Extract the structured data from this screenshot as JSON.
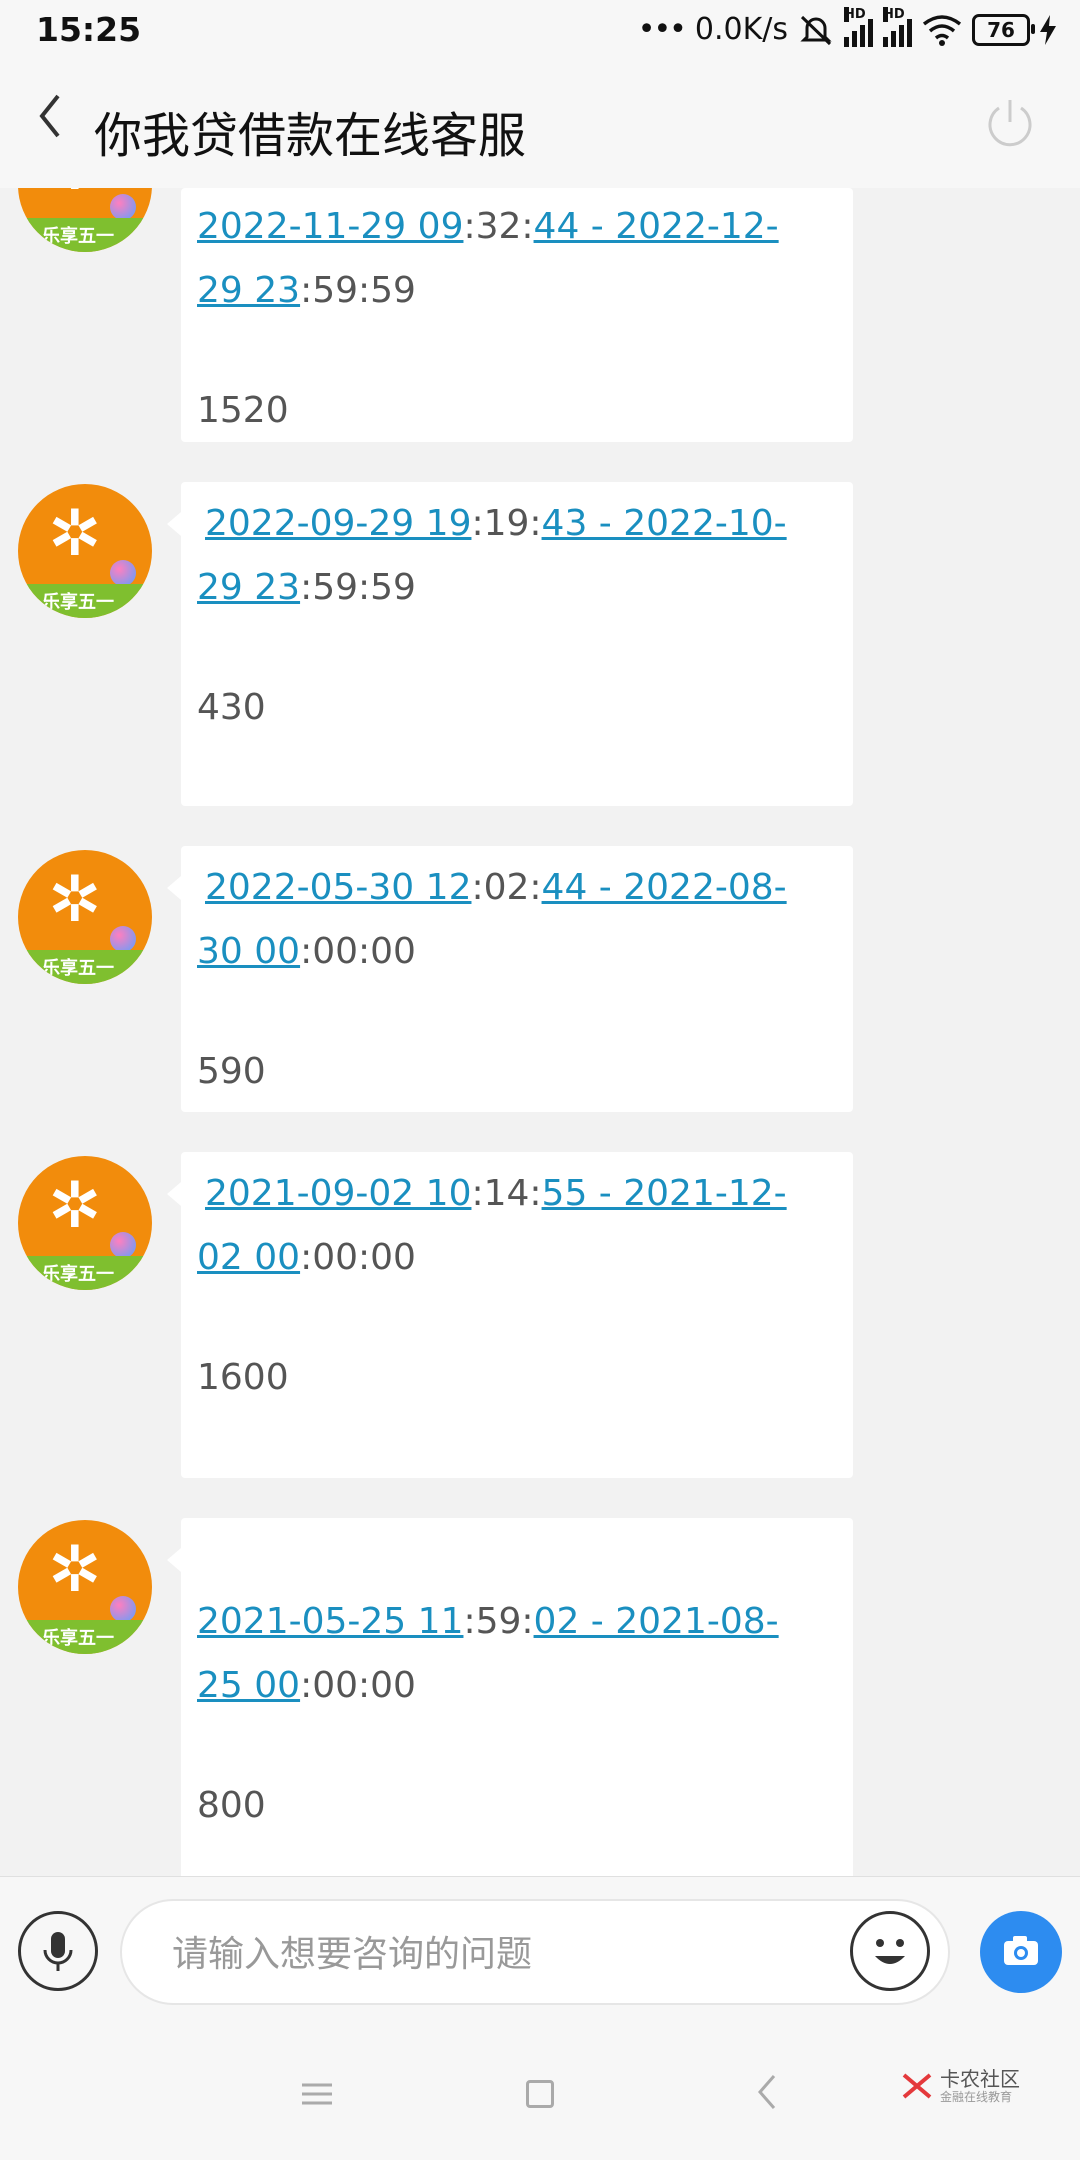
{
  "status_bar": {
    "time": "15:25",
    "net_speed": "0.0K/s",
    "sim1_tag": "HD",
    "sim2_tag": "HD",
    "battery": "76"
  },
  "header": {
    "title": "你我贷借款在线客服"
  },
  "avatar_label": "乐享五一",
  "messages": [
    {
      "l1_link1": "2022-11-29 09",
      "l1_plain": ":32:",
      "l1_link2": "44 - 2022-12-",
      "l2_link": "29 23",
      "l2_plain": ":59:59",
      "amount": "1520"
    },
    {
      "l1_link1": "2022-09-29 19",
      "l1_plain": ":19:",
      "l1_link2": "43 - 2022-10-",
      "l2_link": "29 23",
      "l2_plain": ":59:59",
      "amount": "430"
    },
    {
      "l1_link1": "2022-05-30 12",
      "l1_plain": ":02:",
      "l1_link2": "44 - 2022-08-",
      "l2_link": "30 00",
      "l2_plain": ":00:00",
      "amount": "590"
    },
    {
      "l1_link1": "2021-09-02 10",
      "l1_plain": ":14:",
      "l1_link2": "55 - 2021-12-",
      "l2_link": "02 00",
      "l2_plain": ":00:00",
      "amount": "1600"
    },
    {
      "l1_link1": "2021-05-25 11",
      "l1_plain": ":59:",
      "l1_link2": "02 - 2021-08-",
      "l2_link": "25 00",
      "l2_plain": ":00:00",
      "amount": "800"
    }
  ],
  "input": {
    "placeholder": "请输入想要咨询的问题"
  },
  "watermark": {
    "name": "卡农社区",
    "tagline": "金融在线教育"
  },
  "colors": {
    "link": "#1a8fc0",
    "camera_button": "#2d8cf0",
    "avatar_orange": "#f28c0c",
    "avatar_green": "#7fbf2f"
  }
}
